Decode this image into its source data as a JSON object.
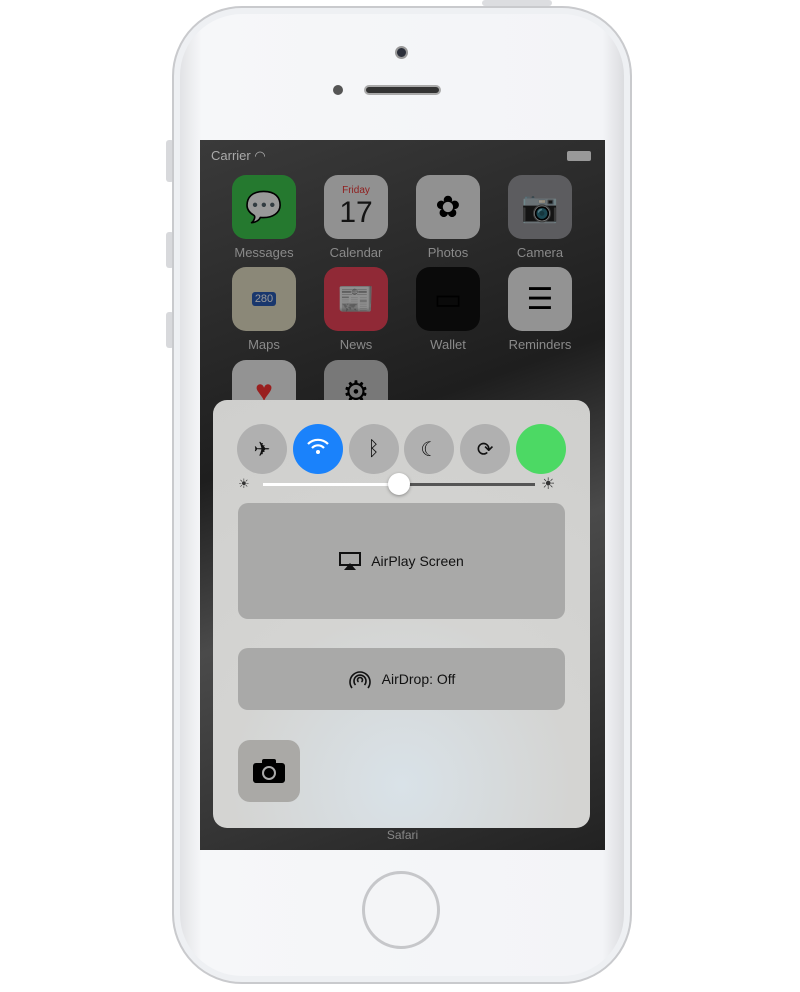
{
  "status_bar": {
    "carrier": "Carrier"
  },
  "apps": [
    {
      "label": "Messages",
      "color": "#3dc94f",
      "glyph": "💬"
    },
    {
      "label": "Calendar",
      "color": "#f2f2f2",
      "day": "Friday",
      "date": "17"
    },
    {
      "label": "Photos",
      "color": "#f2f2f2",
      "glyph": "✿"
    },
    {
      "label": "Camera",
      "color": "#9a9a9e",
      "glyph": "📷"
    },
    {
      "label": "Maps",
      "color": "#e8e2c8",
      "badge": "280"
    },
    {
      "label": "News",
      "color": "#f0445a",
      "glyph": "📰"
    },
    {
      "label": "Wallet",
      "color": "#111111",
      "glyph": "▭"
    },
    {
      "label": "Reminders",
      "color": "#f5f5f5",
      "glyph": "☰"
    },
    {
      "label": "",
      "color": "#f5f5f5",
      "glyph": "♥"
    },
    {
      "label": "",
      "color": "#c8c8c8",
      "glyph": "⚙"
    }
  ],
  "control_center": {
    "toggles": [
      {
        "name": "airplane",
        "glyph": "✈",
        "on": false
      },
      {
        "name": "wifi",
        "glyph": "wifi",
        "on": true,
        "color": "#1a82fb"
      },
      {
        "name": "bluetooth",
        "glyph": "ᛒ",
        "on": false
      },
      {
        "name": "do-not-disturb",
        "glyph": "☾",
        "on": false
      },
      {
        "name": "rotation-lock",
        "glyph": "⟳",
        "on": false
      },
      {
        "name": "green-toggle",
        "glyph": "",
        "on": true,
        "color": "#4cd964"
      }
    ],
    "brightness": 0.5,
    "airplay_label": "AirPlay Screen",
    "airdrop_label": "AirDrop: Off"
  },
  "dock_label": "Safari"
}
